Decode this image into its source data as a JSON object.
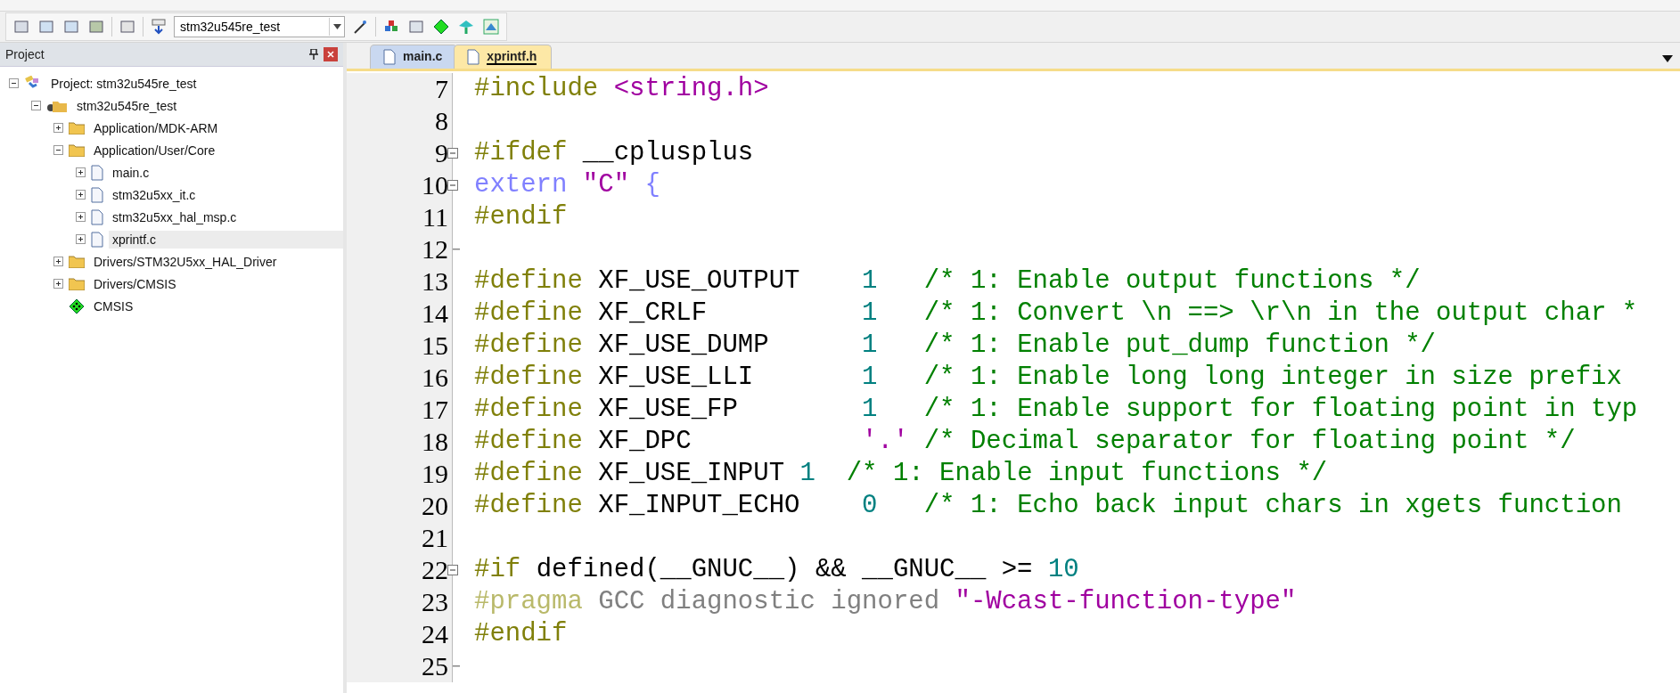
{
  "toolbar": {
    "target": "stm32u545re_test"
  },
  "project_panel": {
    "title": "Project",
    "tree": [
      {
        "kind": "project",
        "label": "Project: stm32u545re_test",
        "expanded": true,
        "children": [
          {
            "kind": "target",
            "label": "stm32u545re_test",
            "expanded": true,
            "children": [
              {
                "kind": "group",
                "label": "Application/MDK-ARM",
                "expanded": false
              },
              {
                "kind": "group",
                "label": "Application/User/Core",
                "expanded": true,
                "children": [
                  {
                    "kind": "file",
                    "label": "main.c",
                    "expanded": false,
                    "selected": false
                  },
                  {
                    "kind": "file",
                    "label": "stm32u5xx_it.c",
                    "expanded": false,
                    "selected": false
                  },
                  {
                    "kind": "file",
                    "label": "stm32u5xx_hal_msp.c",
                    "expanded": false,
                    "selected": false
                  },
                  {
                    "kind": "file",
                    "label": "xprintf.c",
                    "expanded": false,
                    "selected": true
                  }
                ]
              },
              {
                "kind": "group",
                "label": "Drivers/STM32U5xx_HAL_Driver",
                "expanded": false
              },
              {
                "kind": "group",
                "label": "Drivers/CMSIS",
                "expanded": false
              },
              {
                "kind": "component",
                "label": "CMSIS"
              }
            ]
          }
        ]
      }
    ]
  },
  "tabs": [
    {
      "label": "main.c",
      "selected": false
    },
    {
      "label": "xprintf.h",
      "selected": true
    }
  ],
  "editor": {
    "lines": [
      {
        "number": "7",
        "kind": "plain",
        "tokens": [
          {
            "kind": "pp",
            "text": "#include "
          },
          {
            "kind": "str",
            "text": "<string.h>"
          }
        ]
      },
      {
        "number": "8",
        "kind": "plain"
      },
      {
        "number": "9",
        "kind": "foldstart",
        "tokens": [
          {
            "kind": "pp",
            "text": "#ifdef "
          },
          {
            "kind": "plain",
            "text": "__cplusplus"
          }
        ]
      },
      {
        "number": "10",
        "kind": "foldstart",
        "tokens": [
          {
            "kind": "kw",
            "text": "extern "
          },
          {
            "kind": "str",
            "text": "\"C\""
          },
          {
            "kind": "kw",
            "text": " {"
          }
        ]
      },
      {
        "number": "11",
        "kind": "plain",
        "tokens": [
          {
            "kind": "pp",
            "text": "#endif"
          }
        ]
      },
      {
        "number": "12",
        "kind": "foldend"
      },
      {
        "number": "13",
        "kind": "plain",
        "tokens": [
          {
            "kind": "pp",
            "text": "#define "
          },
          {
            "kind": "plain",
            "text": "XF_USE_OUTPUT    "
          },
          {
            "kind": "num",
            "text": "1   "
          },
          {
            "kind": "cmt",
            "text": "/* 1: Enable output functions */"
          }
        ]
      },
      {
        "number": "14",
        "kind": "plain",
        "tokens": [
          {
            "kind": "pp",
            "text": "#define "
          },
          {
            "kind": "plain",
            "text": "XF_CRLF          "
          },
          {
            "kind": "num",
            "text": "1   "
          },
          {
            "kind": "cmt",
            "text": "/* 1: Convert \\n ==> \\r\\n in the output char *"
          }
        ]
      },
      {
        "number": "15",
        "kind": "plain",
        "tokens": [
          {
            "kind": "pp",
            "text": "#define "
          },
          {
            "kind": "plain",
            "text": "XF_USE_DUMP      "
          },
          {
            "kind": "num",
            "text": "1   "
          },
          {
            "kind": "cmt",
            "text": "/* 1: Enable put_dump function */"
          }
        ]
      },
      {
        "number": "16",
        "kind": "plain",
        "tokens": [
          {
            "kind": "pp",
            "text": "#define "
          },
          {
            "kind": "plain",
            "text": "XF_USE_LLI       "
          },
          {
            "kind": "num",
            "text": "1   "
          },
          {
            "kind": "cmt",
            "text": "/* 1: Enable long long integer in size prefix"
          }
        ]
      },
      {
        "number": "17",
        "kind": "plain",
        "tokens": [
          {
            "kind": "pp",
            "text": "#define "
          },
          {
            "kind": "plain",
            "text": "XF_USE_FP        "
          },
          {
            "kind": "num",
            "text": "1   "
          },
          {
            "kind": "cmt",
            "text": "/* 1: Enable support for floating point in typ"
          }
        ]
      },
      {
        "number": "18",
        "kind": "plain",
        "tokens": [
          {
            "kind": "pp",
            "text": "#define "
          },
          {
            "kind": "plain",
            "text": "XF_DPC           "
          },
          {
            "kind": "str",
            "text": "'.' "
          },
          {
            "kind": "cmt",
            "text": "/* Decimal separator for floating point */"
          }
        ]
      },
      {
        "number": "19",
        "kind": "plain",
        "tokens": [
          {
            "kind": "pp",
            "text": "#define "
          },
          {
            "kind": "plain",
            "text": "XF_USE_INPUT "
          },
          {
            "kind": "num",
            "text": "1  "
          },
          {
            "kind": "cmt",
            "text": "/* 1: Enable input functions */"
          }
        ]
      },
      {
        "number": "20",
        "kind": "plain",
        "tokens": [
          {
            "kind": "pp",
            "text": "#define "
          },
          {
            "kind": "plain",
            "text": "XF_INPUT_ECHO    "
          },
          {
            "kind": "num",
            "text": "0   "
          },
          {
            "kind": "cmt",
            "text": "/* 1: Echo back input chars in xgets function"
          }
        ]
      },
      {
        "number": "21",
        "kind": "plain"
      },
      {
        "number": "22",
        "kind": "foldstart",
        "tokens": [
          {
            "kind": "pp",
            "text": "#if "
          },
          {
            "kind": "plain",
            "text": "defined(__GNUC__) && __GNUC__ >= "
          },
          {
            "kind": "num",
            "text": "10"
          }
        ]
      },
      {
        "number": "23",
        "kind": "plain",
        "tokens": [
          {
            "kind": "ppdim",
            "text": "#pragma "
          },
          {
            "kind": "dim",
            "text": "GCC diagnostic ignored "
          },
          {
            "kind": "str",
            "text": "\"-Wcast-function-type\""
          }
        ]
      },
      {
        "number": "24",
        "kind": "plain",
        "tokens": [
          {
            "kind": "pp",
            "text": "#endif"
          }
        ]
      },
      {
        "number": "25",
        "kind": "foldend"
      }
    ]
  }
}
